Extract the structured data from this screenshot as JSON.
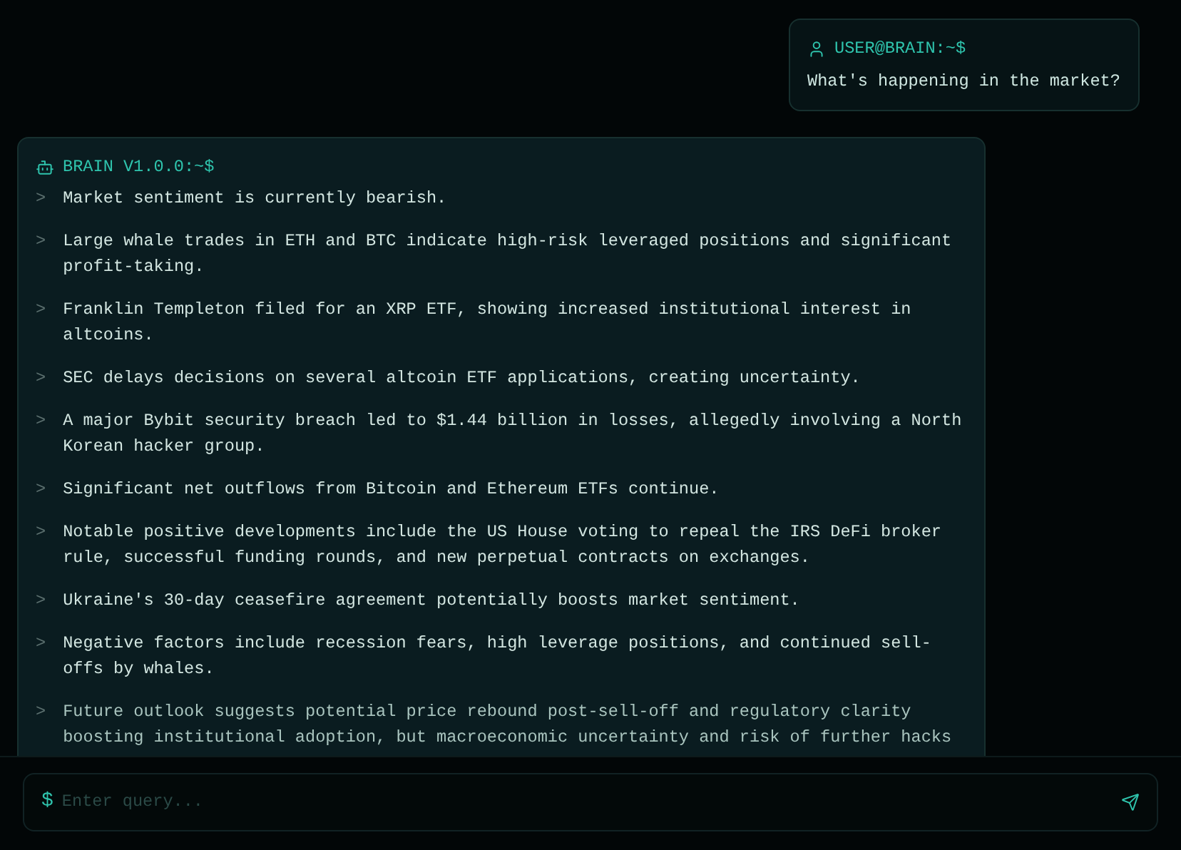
{
  "user_message": {
    "prompt": "USER@BRAIN:~$",
    "text": "What's happening in the market?"
  },
  "bot_message": {
    "prompt": "BRAIN V1.0.0:~$",
    "marker": ">",
    "items": [
      "Market sentiment is currently bearish.",
      "Large whale trades in ETH and BTC indicate high-risk leveraged positions and significant profit-taking.",
      "Franklin Templeton filed for an XRP ETF, showing increased institutional interest in altcoins.",
      "SEC delays decisions on several altcoin ETF applications, creating uncertainty.",
      "A major Bybit security breach led to $1.44 billion in losses, allegedly involving a North Korean hacker group.",
      "Significant net outflows from Bitcoin and Ethereum ETFs continue.",
      "Notable positive developments include the US House voting to repeal the IRS DeFi broker rule, successful funding rounds, and new perpetual contracts on exchanges.",
      "Ukraine's 30-day ceasefire agreement potentially boosts market sentiment.",
      "Negative factors include recession fears, high leverage positions, and continued sell-offs by whales.",
      "Future outlook suggests potential price rebound post-sell-off and regulatory clarity boosting institutional adoption, but macroeconomic uncertainty and risk of further hacks"
    ]
  },
  "input": {
    "prefix": "$",
    "placeholder": "Enter query..."
  }
}
